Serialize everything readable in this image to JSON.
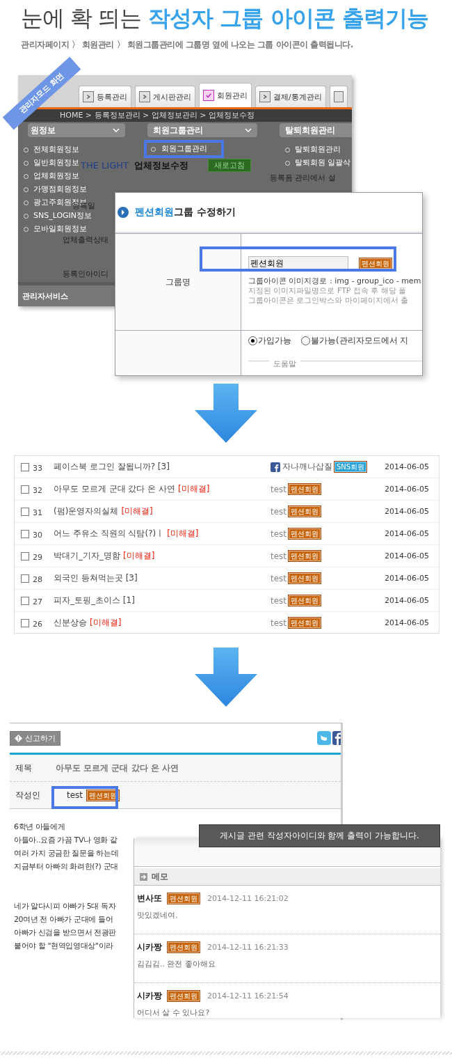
{
  "title": {
    "plain": "눈에 확 띄는",
    "highlight": "작성자 그룹 아이콘 출력기능"
  },
  "subtitle": "관리자페이지 〉 회원관리 〉 회원그룹관리에 그룹명 옆에 나오는 그룹 아이콘이 출력됩니다.",
  "admin_screen": {
    "ribbon": "관리자모드 화면",
    "tabs": [
      {
        "label": "등록관리",
        "selected": false
      },
      {
        "label": "게시판관리",
        "selected": false
      },
      {
        "label": "회원관리",
        "selected": true
      },
      {
        "label": "결제/통계관리",
        "selected": false
      }
    ],
    "breadcrumb": "HOME > 등록정보관리 > 업체정보관리 > 업체정보수정",
    "menus": [
      {
        "title": "원정보",
        "items": [
          {
            "label": "전체회원정보",
            "highlighted": false
          },
          {
            "label": "일반회원정보",
            "highlighted": false
          },
          {
            "label": "업체회원정보",
            "highlighted": false
          },
          {
            "label": "가맹점회원정보",
            "highlighted": false
          },
          {
            "label": "광고주회원정보",
            "highlighted": false
          },
          {
            "label": "SNS_LOGIN정보",
            "highlighted": false
          },
          {
            "label": "모바일회원정보",
            "highlighted": false
          }
        ]
      },
      {
        "title": "회원그룹관리",
        "items": [
          {
            "label": "회원그룹관리",
            "highlighted": true
          }
        ]
      },
      {
        "title": "탈퇴회원관리",
        "items": [
          {
            "label": "탈퇴회원관리",
            "highlighted": false
          },
          {
            "label": "탈퇴회원 일괄삭",
            "highlighted": false
          }
        ]
      }
    ],
    "page_heading": {
      "logo": "THE LIGHT",
      "title": "업체정보수정",
      "refresh_button": "새로고침",
      "note": "등록폼 관리에서 설"
    },
    "field_labels": [
      "등록일",
      "업체출력상태",
      "등록인아이디"
    ],
    "footer": "관리자서비스"
  },
  "group_dialog": {
    "title_name": "펜션회원",
    "title_rest": "그룹 수정하기",
    "label": "그룹명",
    "value": "펜션회원",
    "icon_badge": {
      "text": "펜션회원",
      "kind": "pension"
    },
    "notes": [
      "그룹아이콘 이미지경로 : img - group_ico - mem",
      "지정된 이미지파일명으로 FTP 접속 후 해당 폴",
      "그룹아이콘은 로그인박스와 마이페이지에서 출"
    ],
    "join_options": [
      {
        "label": "가입가능",
        "selected": true
      },
      {
        "label": "불가능(관리자모드에서 지",
        "selected": false
      }
    ],
    "help_legend": "도움말"
  },
  "board_list": {
    "rows": [
      {
        "checked": false,
        "num": "33",
        "title": "페이스북 로그인 잘됩니까? [3]",
        "author": "자나깨나삽질",
        "facebook": true,
        "badge": {
          "text": "SNS회원",
          "kind": "sns"
        },
        "date": "2014-06-05"
      },
      {
        "checked": false,
        "num": "32",
        "title": "아무도 모르게 군대 갔다 온 사연",
        "status": "[미해결]",
        "author": "test",
        "facebook": false,
        "badge": {
          "text": "펜션회원",
          "kind": "pension"
        },
        "date": "2014-06-05"
      },
      {
        "checked": false,
        "num": "31",
        "title": "(펌)운영자의실체",
        "status": "[미해결]",
        "author": "test",
        "facebook": false,
        "badge": {
          "text": "펜션회원",
          "kind": "pension"
        },
        "date": "2014-06-05"
      },
      {
        "checked": false,
        "num": "30",
        "title": "어느 주유소 직원의 식탐(?)ㅣ",
        "status": "[미해결]",
        "author": "test",
        "facebook": false,
        "badge": {
          "text": "펜션회원",
          "kind": "pension"
        },
        "date": "2014-06-05"
      },
      {
        "checked": false,
        "num": "29",
        "title": "박대기_기자_명함",
        "status": "[미해결]",
        "author": "test",
        "facebook": false,
        "badge": {
          "text": "펜션회원",
          "kind": "pension"
        },
        "date": "2014-06-05"
      },
      {
        "checked": false,
        "num": "28",
        "title": "외국인 등쳐먹는곳 [3]",
        "author": "test",
        "facebook": false,
        "badge": {
          "text": "펜션회원",
          "kind": "pension"
        },
        "date": "2014-06-05"
      },
      {
        "checked": false,
        "num": "27",
        "title": "피자_토핑_초이스 [1]",
        "author": "test",
        "facebook": false,
        "badge": {
          "text": "펜션회원",
          "kind": "pension"
        },
        "date": "2014-06-05"
      },
      {
        "checked": false,
        "num": "26",
        "title": "신분상승",
        "status": "[미해결]",
        "author": "test",
        "facebook": false,
        "badge": {
          "text": "펜션회원",
          "kind": "pension"
        },
        "date": "2014-06-05"
      }
    ]
  },
  "post": {
    "report_button": "신고하기",
    "subject_label": "제목",
    "subject": "아무도 모르게 군대 갔다 온 사연",
    "author_label": "작성인",
    "author": "test",
    "author_badge": {
      "text": "펜션회원",
      "kind": "pension"
    },
    "body": [
      [
        "6학년 아들에게",
        "아들아..요즘 가끔 TV나 영화 같",
        "여러 가지 궁금한 질문을 하는데",
        "지금부터 아빠의 화려한(?) 군대"
      ],
      [
        "네가 알다시피 아빠가 5대 독자",
        "20여년 전 아빠가 군대에 들어",
        "아빠가 신검을 받으면서 전광판",
        "붙어야 할 \"현역입영대상\"이라"
      ]
    ]
  },
  "tooltip": "게시글 관련 작성자아이디와 함께 출력이 가능합니다.",
  "memo": {
    "title": "메모",
    "comments": [
      {
        "author": "변사또",
        "badge": {
          "text": "펜션회원",
          "kind": "pension"
        },
        "datetime": "2014-12-11 16:21:02",
        "text": "맛있겠네여."
      },
      {
        "author": "시카짱",
        "badge": {
          "text": "펜션회원",
          "kind": "pension"
        },
        "datetime": "2014-12-11 16:21:33",
        "text": "김김김.. 완전 좋아해요"
      },
      {
        "author": "시카짱",
        "badge": {
          "text": "펜션회원",
          "kind": "pension"
        },
        "datetime": "2014-12-11 16:21:54",
        "text": "어디서 살 수 있나요?"
      }
    ]
  }
}
